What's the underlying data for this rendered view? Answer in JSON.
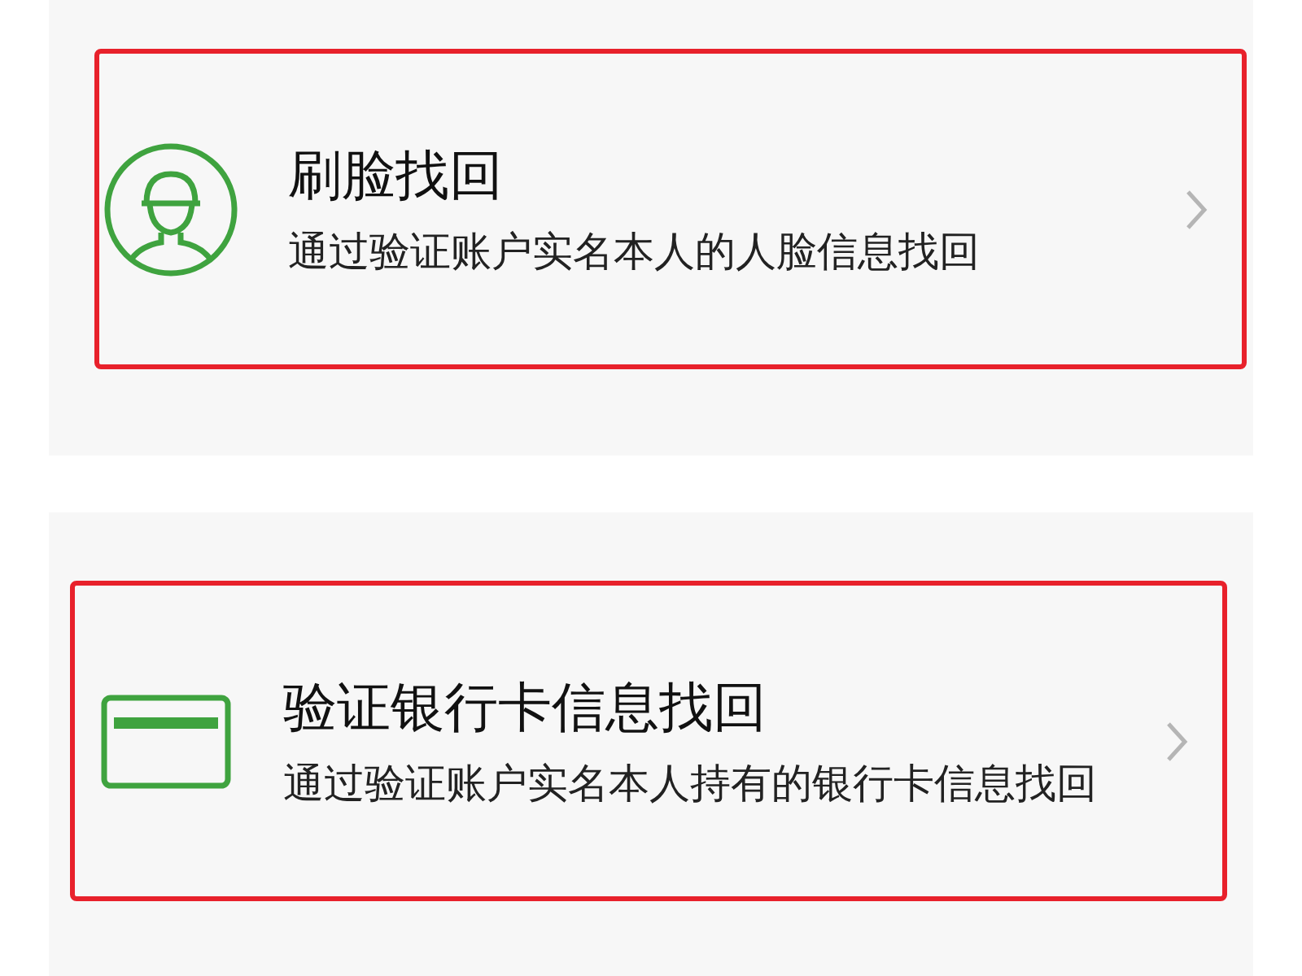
{
  "options": [
    {
      "kind": "face",
      "title": "刷脸找回",
      "description": "通过验证账户实名本人的人脸信息找回",
      "highlighted": true
    },
    {
      "kind": "card",
      "title": "验证银行卡信息找回",
      "description": "通过验证账户实名本人持有的银行卡信息找回",
      "highlighted": true
    }
  ]
}
